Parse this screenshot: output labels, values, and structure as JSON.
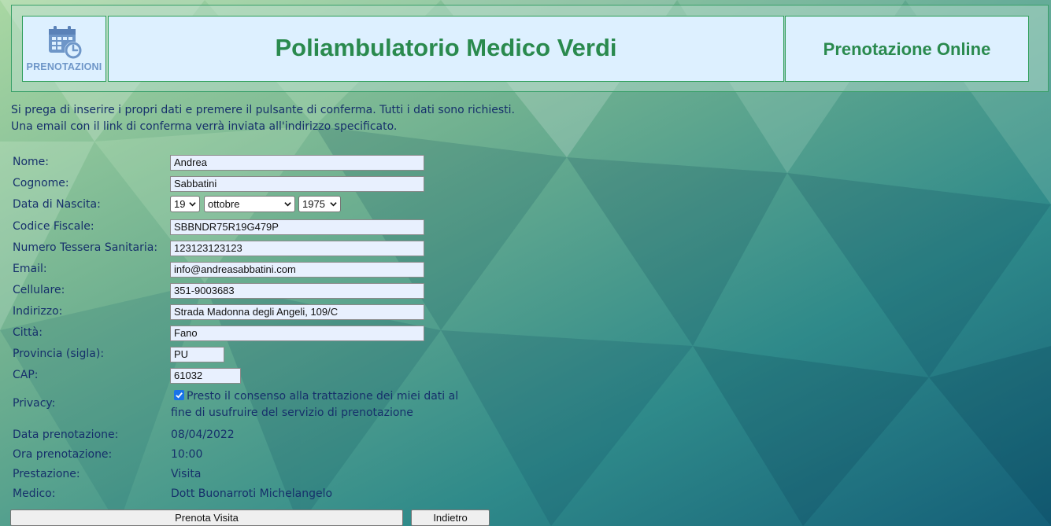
{
  "header": {
    "logo_text": "PRENOTAZIONI",
    "logo_icon": "calendar-clock-icon",
    "site_title": "Poliambulatorio Medico Verdi",
    "section_title": "Prenotazione Online"
  },
  "intro": {
    "line1": "Si prega di inserire i propri dati e premere il pulsante di conferma. Tutti i dati sono richiesti.",
    "line2": "Una email con il link di conferma verrà inviata all'indirizzo specificato."
  },
  "form": {
    "nome": {
      "label": "Nome:",
      "value": "Andrea"
    },
    "cognome": {
      "label": "Cognome:",
      "value": "Sabbatini"
    },
    "nascita": {
      "label": "Data di Nascita:",
      "day": "19",
      "month": "ottobre",
      "year": "1975"
    },
    "codice_fiscale": {
      "label": "Codice Fiscale:",
      "value": "SBBNDR75R19G479P"
    },
    "tessera": {
      "label": "Numero Tessera Sanitaria:",
      "value": "123123123123"
    },
    "email": {
      "label": "Email:",
      "value": "info@andreasabbatini.com"
    },
    "cellulare": {
      "label": "Cellulare:",
      "value": "351-9003683"
    },
    "indirizzo": {
      "label": "Indirizzo:",
      "value": "Strada Madonna degli Angeli, 109/C"
    },
    "citta": {
      "label": "Città:",
      "value": "Fano"
    },
    "provincia": {
      "label": "Provincia (sigla):",
      "value": "PU"
    },
    "cap": {
      "label": "CAP:",
      "value": "61032"
    },
    "privacy": {
      "label": "Privacy:",
      "checked": true,
      "text": "Presto il consenso alla trattazione dei miei dati al fine di usufruire del servizio di prenotazione"
    }
  },
  "booking": {
    "data": {
      "label": "Data prenotazione:",
      "value": "08/04/2022"
    },
    "ora": {
      "label": "Ora prenotazione:",
      "value": "10:00"
    },
    "prestazione": {
      "label": "Prestazione:",
      "value": "Visita"
    },
    "medico": {
      "label": "Medico:",
      "value": "Dott Buonarroti Michelangelo"
    }
  },
  "buttons": {
    "submit": "Prenota Visita",
    "back": "Indietro"
  },
  "colors": {
    "accent_green": "#2a8a4e",
    "header_box_bg": "#ddf0ff",
    "text_navy": "#16306b",
    "input_bg": "#e8f0fe"
  }
}
